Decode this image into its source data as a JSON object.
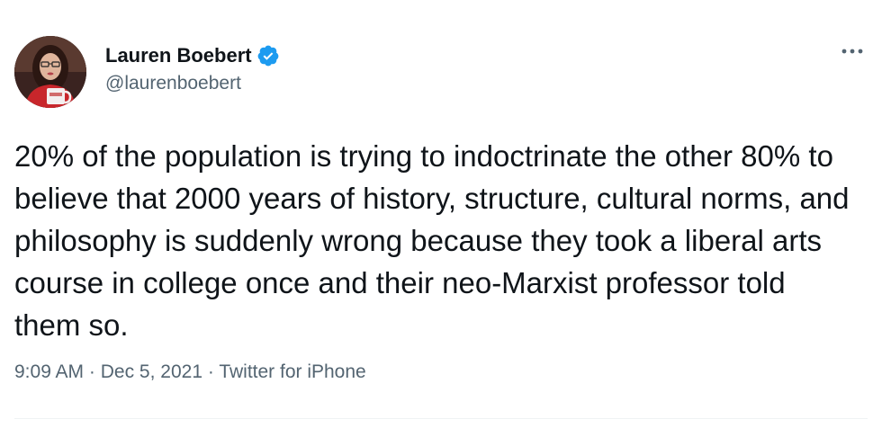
{
  "author": {
    "display_name": "Lauren Boebert",
    "handle": "@laurenboebert",
    "verified": true,
    "avatar_icon": "profile-photo"
  },
  "tweet": {
    "text": "20% of the population is trying to indoctrinate the other 80% to believe that 2000 years of history, structure, cultural norms, and philosophy is suddenly wrong because they took a liberal arts course in college once and their neo-Marxist professor told them so.",
    "time": "9:09 AM",
    "date": "Dec 5, 2021",
    "source": "Twitter for iPhone",
    "separator": "·"
  },
  "icons": {
    "verified": "verified-badge-icon",
    "more": "more-options-icon"
  },
  "colors": {
    "verified_blue": "#1d9bf0",
    "secondary_text": "#536471",
    "primary_text": "#0f1419"
  }
}
